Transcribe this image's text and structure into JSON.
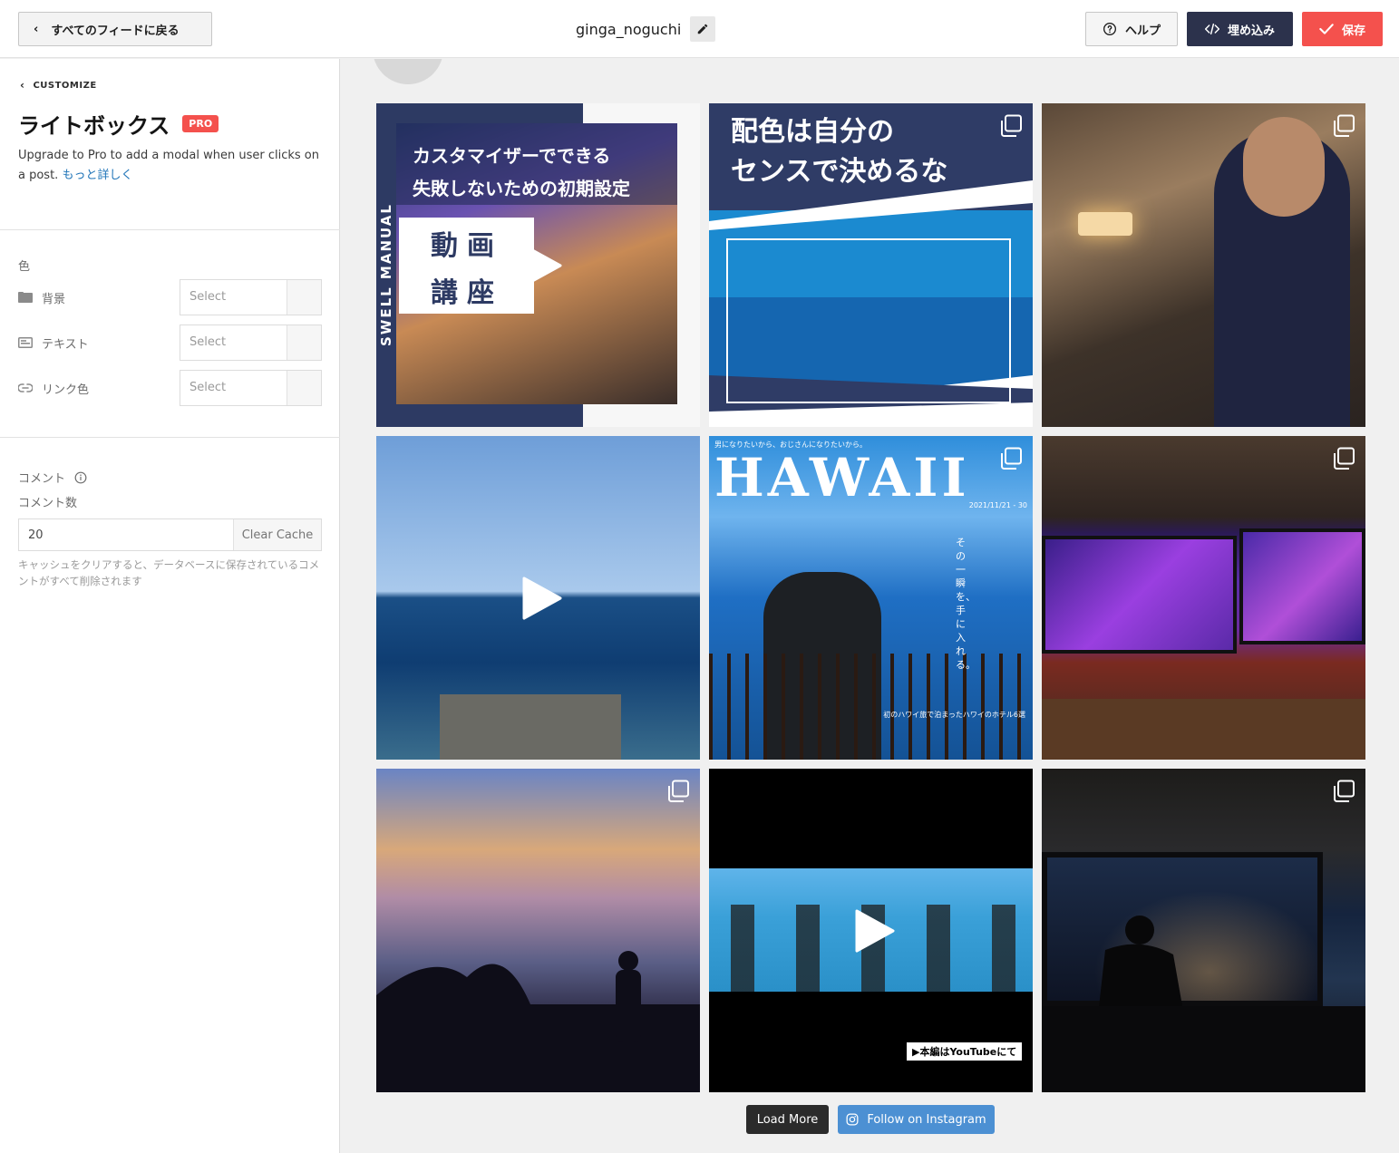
{
  "topbar": {
    "back_label": "すべてのフィードに戻る",
    "feed_title": "ginga_noguchi",
    "help_label": "ヘルプ",
    "embed_label": "埋め込み",
    "save_label": "保存"
  },
  "sidebar": {
    "breadcrumb": "CUSTOMIZE",
    "title": "ライトボックス",
    "badge": "PRO",
    "upgrade_text": "Upgrade to Pro to add a modal when user clicks on a post.",
    "learn_more": "もっと詳しく",
    "color_group_label": "色",
    "color_rows": [
      {
        "label": "背景",
        "icon": "folder-icon",
        "placeholder": "Select"
      },
      {
        "label": "テキスト",
        "icon": "text-icon",
        "placeholder": "Select"
      },
      {
        "label": "リンク色",
        "icon": "link-icon",
        "placeholder": "Select"
      }
    ],
    "comments_label": "コメント",
    "comment_count_label": "コメント数",
    "comment_count_value": "20",
    "clear_cache_label": "Clear Cache",
    "cache_help": "キャッシュをクリアすると、データベースに保存されているコメントがすべて削除されます"
  },
  "preview": {
    "posts": [
      {
        "type": "video",
        "caption": "カスタマイザーでできる\n失敗しないための初期設定",
        "side_text": "SWELL MANUAL",
        "box_text": "動画\n講座"
      },
      {
        "type": "carousel",
        "caption": "配色は自分の\nセンスで決めるな"
      },
      {
        "type": "carousel"
      },
      {
        "type": "video"
      },
      {
        "type": "carousel",
        "caption": "HAWAII",
        "tagline": "男になりたいから、おじさんになりたいから。",
        "date": "2021/11/21 - 30",
        "vertical": "その一瞬を、手に入れる。",
        "sub": "初のハワイ旅で泊まったハワイのホテル6選"
      },
      {
        "type": "carousel"
      },
      {
        "type": "carousel"
      },
      {
        "type": "video",
        "banner": "▶本編はYouTubeにて"
      },
      {
        "type": "carousel"
      }
    ],
    "load_more_label": "Load More",
    "follow_label": "Follow on Instagram"
  },
  "colors": {
    "accent_red": "#f4514d",
    "navy": "#2c324c",
    "link_blue": "#1f74b8",
    "instagram_blue": "#4c90d3"
  }
}
